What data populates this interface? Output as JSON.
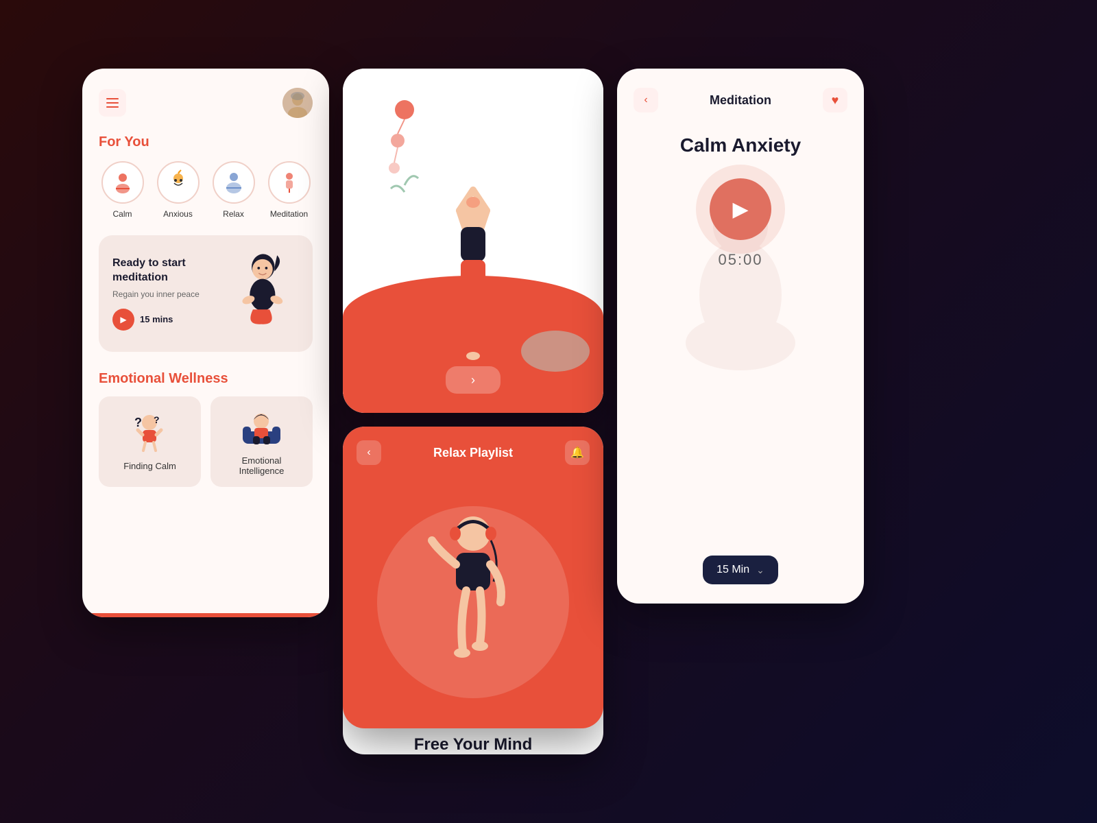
{
  "screen_left": {
    "menu_label": "≡",
    "for_you_title": "For You",
    "moods": [
      {
        "label": "Calm",
        "emoji": "🧘"
      },
      {
        "label": "Anxious",
        "emoji": "⚡"
      },
      {
        "label": "Relax",
        "emoji": "🧘"
      },
      {
        "label": "Meditation",
        "emoji": "💻"
      }
    ],
    "banner": {
      "title": "Ready to start meditation",
      "subtitle": "Regain you inner peace",
      "duration": "15 mins"
    },
    "emotional_wellness_title": "Emotional Wellness",
    "wellness_cards": [
      {
        "label": "Finding Calm"
      },
      {
        "label": "Emotional Intelligence"
      }
    ]
  },
  "screen_middle": {
    "next_button": "›",
    "playlist_title": "Relax Playlist",
    "back_label": "‹",
    "free_mind_title": "Free Your Mind"
  },
  "screen_right": {
    "back_label": "‹",
    "title": "Meditation",
    "heart": "♥",
    "calm_title": "Calm Anxiety",
    "timer": "05:00",
    "duration_label": "15 Min",
    "chevron": "⌄"
  }
}
